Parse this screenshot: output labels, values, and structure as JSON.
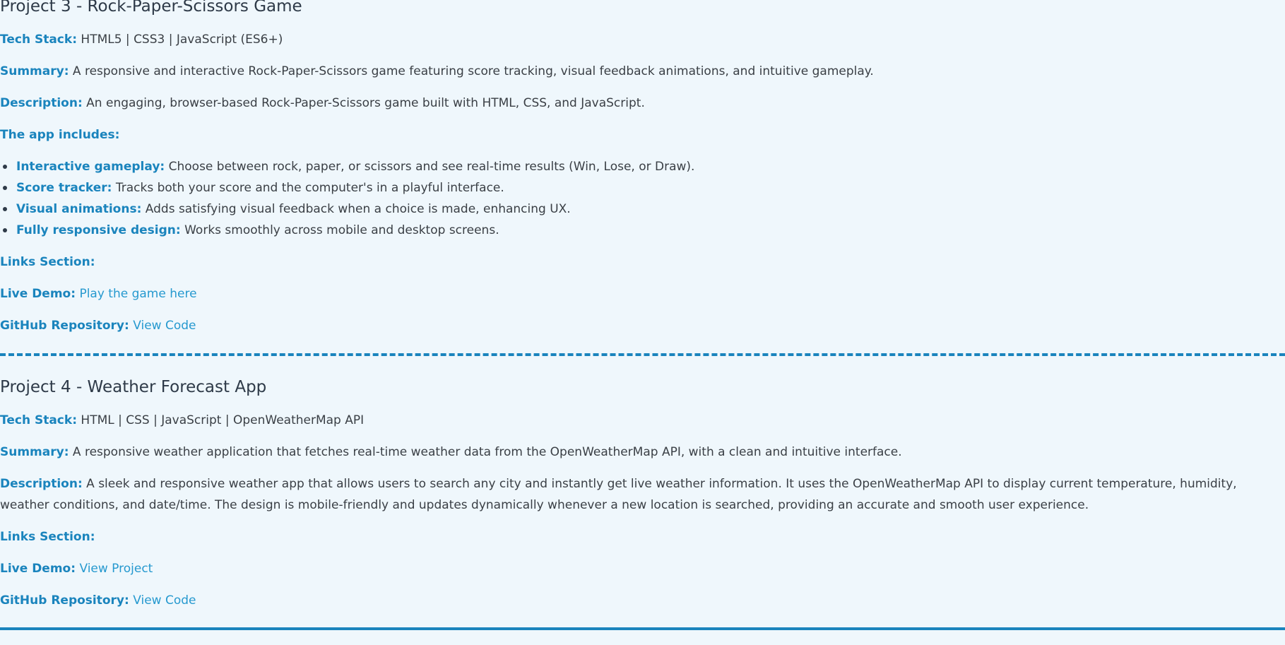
{
  "project3": {
    "title": "Project 3 - Rock-Paper-Scissors Game",
    "tech_label": "Tech Stack:",
    "tech_value": "HTML5 | CSS3 | JavaScript (ES6+)",
    "summary_label": "Summary:",
    "summary_value": "A responsive and interactive Rock-Paper-Scissors game featuring score tracking, visual feedback animations, and intuitive gameplay.",
    "description_label": "Description:",
    "description_value": "An engaging, browser-based Rock-Paper-Scissors game built with HTML, CSS, and JavaScript.",
    "includes_heading": "The app includes:",
    "features": [
      {
        "label": "Interactive gameplay:",
        "text": "Choose between rock, paper, or scissors and see real-time results (Win, Lose, or Draw)."
      },
      {
        "label": "Score tracker:",
        "text": "Tracks both your score and the computer's in a playful interface."
      },
      {
        "label": "Visual animations:",
        "text": "Adds satisfying visual feedback when a choice is made, enhancing UX."
      },
      {
        "label": "Fully responsive design:",
        "text": "Works smoothly across mobile and desktop screens."
      }
    ],
    "links_heading": "Links Section:",
    "demo_label": "Live Demo:",
    "demo_link": "Play the game here",
    "github_label": "GitHub Repository:",
    "github_link": "View Code"
  },
  "project4": {
    "title": "Project 4 - Weather Forecast App",
    "tech_label": "Tech Stack:",
    "tech_value": "HTML | CSS | JavaScript | OpenWeatherMap API",
    "summary_label": "Summary:",
    "summary_value": "A responsive weather application that fetches real-time weather data from the OpenWeatherMap API, with a clean and intuitive interface.",
    "description_label": "Description:",
    "description_value": "A sleek and responsive weather app that allows users to search any city and instantly get live weather information. It uses the OpenWeatherMap API to display current temperature, humidity, weather conditions, and date/time. The design is mobile-friendly and updates dynamically whenever a new location is searched, providing an accurate and smooth user experience.",
    "links_heading": "Links Section:",
    "demo_label": "Live Demo:",
    "demo_link": "View Project",
    "github_label": "GitHub Repository:",
    "github_link": "View Code"
  }
}
